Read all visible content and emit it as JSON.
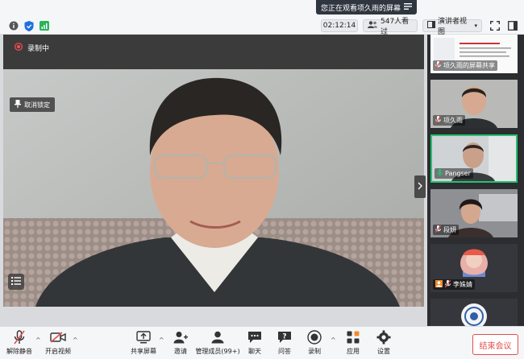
{
  "top": {
    "banner_text": "您正在观看项久雨的屏幕",
    "timer": "02:12:14",
    "viewers": "547人看过",
    "view_mode": "演讲者视图"
  },
  "main": {
    "rec_label": "录制中",
    "unpin_label": "取消锁定"
  },
  "participants": [
    {
      "name": "项久雨的屏幕共享",
      "active": false
    },
    {
      "name": "项久雨",
      "active": false
    },
    {
      "name": "Pangser",
      "active": true
    },
    {
      "name": "段妍",
      "active": false
    },
    {
      "name": "李姝婧",
      "active": false
    },
    {
      "name": "",
      "active": false
    }
  ],
  "toolbar": {
    "unmute": "解除静音",
    "start_video": "开启视频",
    "share_screen": "共享屏幕",
    "invite": "邀请",
    "members": "管理成员(99+)",
    "chat": "聊天",
    "qa": "问答",
    "record": "录制",
    "apps": "应用",
    "settings": "设置",
    "end_meeting": "结束会议"
  },
  "colors": {
    "accent_green": "#27c06e",
    "end_red": "#e34d4d"
  }
}
